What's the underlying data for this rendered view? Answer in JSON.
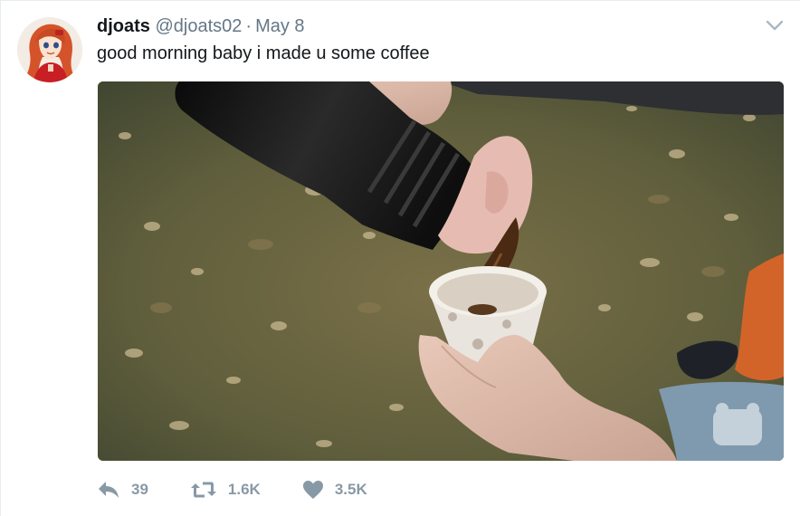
{
  "tweet": {
    "display_name": "djoats",
    "handle": "@djoats02",
    "separator": "·",
    "date": "May 8",
    "text": "good morning baby i made u some coffee",
    "actions": {
      "reply_count": "39",
      "retweet_count": "1.6K",
      "like_count": "3.5K"
    }
  },
  "icons": {
    "more": "chevron-down-icon",
    "reply": "reply-icon",
    "retweet": "retweet-icon",
    "like": "heart-icon"
  },
  "colors": {
    "text": "#14171a",
    "secondary": "#657786",
    "action": "#8899a6"
  }
}
